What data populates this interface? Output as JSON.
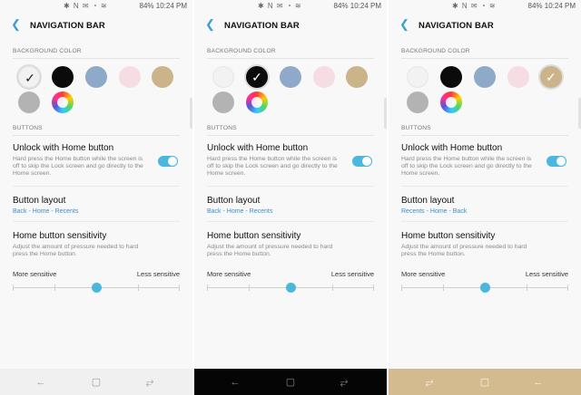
{
  "status": {
    "icons": "✱ N ✉ ◔ ≋",
    "battery": "84%",
    "time": "10:24 PM"
  },
  "header": {
    "title": "NAVIGATION BAR"
  },
  "sections": {
    "background_color": "BACKGROUND COLOR",
    "buttons": "BUTTONS"
  },
  "unlock": {
    "title": "Unlock with Home button",
    "desc": "Hard press the Home button while the screen is off to skip the Lock screen and go directly to the Home screen."
  },
  "layout": {
    "title": "Button layout"
  },
  "sensitivity": {
    "title": "Home button sensitivity",
    "desc": "Adjust the amount of pressure needed to hard press the Home button.",
    "more": "More sensitive",
    "less": "Less sensitive",
    "level_fraction": 0.5
  },
  "panels": [
    {
      "selected_color": "white",
      "layout_value": "Back - Home - Recents",
      "navbar_color": "#f0f0f0",
      "navbar_icon_color": "#9a9a9a",
      "nav_order": [
        "back-icon",
        "home-icon",
        "recents-icon"
      ]
    },
    {
      "selected_color": "black",
      "layout_value": "Back - Home - Recents",
      "navbar_color": "#050505",
      "navbar_icon_color": "#8a8a8a",
      "nav_order": [
        "back-icon",
        "home-icon",
        "recents-icon"
      ]
    },
    {
      "selected_color": "gold",
      "layout_value": "Recents - Home - Back",
      "navbar_color": "#d4bb8f",
      "navbar_icon_color": "#fbf5ea",
      "nav_order": [
        "recents-icon",
        "home-icon",
        "back-icon"
      ]
    }
  ],
  "colors": {
    "white": "#f2f2f2",
    "black": "#0b0b0b",
    "blue": "#8fa9c9",
    "pink": "#f6dde3",
    "gold": "#cbb48a",
    "gray": "#b3b3b3",
    "accent": "#4cb7de",
    "link": "#3a8fcc"
  },
  "icons": {
    "back": "arrow-left-icon",
    "check": "checkmark-icon",
    "wheel": "color-wheel-icon"
  }
}
